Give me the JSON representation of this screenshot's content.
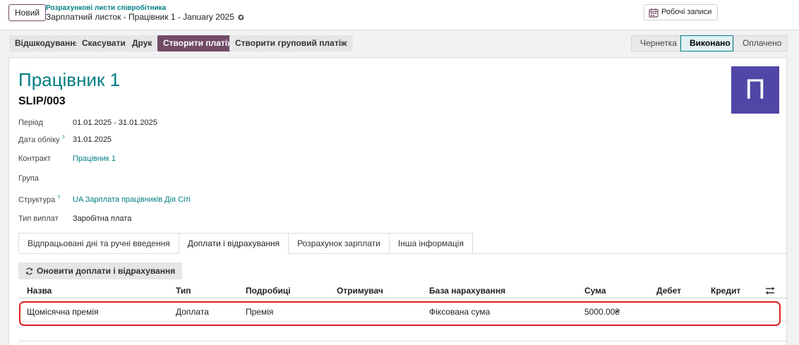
{
  "topbar": {
    "new_label": "Новий",
    "breadcrumb_parent": "Розрахункові листи співробітника",
    "breadcrumb_current": "Зарплатний листок - Працівник 1 - January 2025",
    "work_entries_label": "Робочі записи"
  },
  "actions": {
    "refund": "Відшкодування",
    "cancel": "Скасувати",
    "print": "Друк",
    "create_payment": "Створити платіж",
    "create_group_payment": "Створити груповий платіж"
  },
  "status": {
    "draft": "Чернетка",
    "done": "Виконано",
    "paid": "Оплачено",
    "current": "done"
  },
  "sheet": {
    "employee_name": "Працівник 1",
    "slip_number": "SLIP/003",
    "avatar_letter": "П",
    "avatar_color": "#5046a5",
    "fields": {
      "period_label": "Період",
      "period_value": "01.01.2025 - 31.01.2025",
      "accounting_date_label": "Дата обліку",
      "accounting_date_value": "31.01.2025",
      "contract_label": "Контракт",
      "contract_value": "Працівник 1",
      "group_label": "Група",
      "structure_label": "Структура",
      "structure_value": "UA Зарплата працівників Дія Сіті",
      "payment_type_label": "Тип виплат",
      "payment_type_value": "Заробітна плата",
      "help_mark": "?"
    },
    "tabs": [
      {
        "label": "Відпрацьовані дні та ручні введення"
      },
      {
        "label": "Доплати і відрахування"
      },
      {
        "label": "Розрахунок зарплати"
      },
      {
        "label": "Інша інформація"
      }
    ],
    "refresh_button": "Оновити доплати і відрахування",
    "table": {
      "columns": [
        "Назва",
        "Тип",
        "Подробиці",
        "Отримувач",
        "База нарахування",
        "Сума",
        "Дебет",
        "Кредит"
      ],
      "rows": [
        {
          "name": "Щомісячна премія",
          "type": "Доплата",
          "details": "Премія",
          "recipient": "",
          "base": "Фіксована сума",
          "amount": "5000.00₴",
          "debit": "",
          "credit": ""
        }
      ]
    }
  },
  "colors": {
    "primary": "#714b67",
    "link": "#017e84",
    "highlight": "#e0201c"
  }
}
